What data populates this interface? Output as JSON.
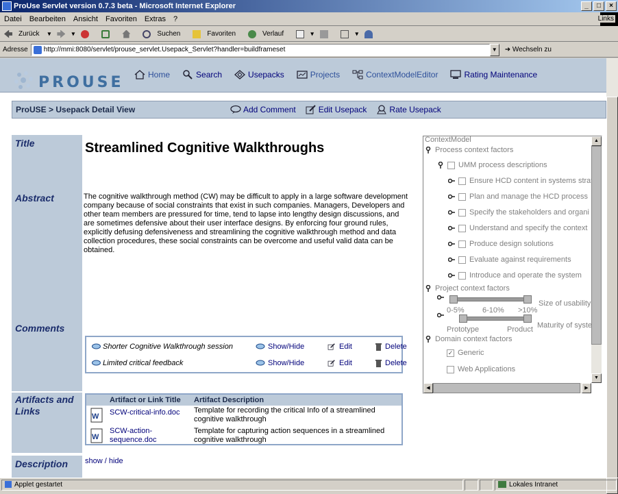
{
  "window": {
    "title": "ProUse Servlet version 0.7.3 beta - Microsoft Internet Explorer"
  },
  "menubar": {
    "items": [
      "Datei",
      "Bearbeiten",
      "Ansicht",
      "Favoriten",
      "Extras",
      "?"
    ],
    "links_label": "Links"
  },
  "toolbar": {
    "back": "Zurück",
    "search": "Suchen",
    "favorites": "Favoriten",
    "history": "Verlauf"
  },
  "addressbar": {
    "label": "Adresse",
    "url": "http://mmi:8080/servlet/prouse_servlet.Usepack_Servlet?handler=buildframeset",
    "go_label": "Wechseln zu"
  },
  "header": {
    "logo": "PROUSE",
    "nav": {
      "home": "Home",
      "search": "Search",
      "usepacks": "Usepacks",
      "projects": "Projects",
      "context_model_editor": "ContextModelEditor",
      "rating_maintenance": "Rating Maintenance"
    }
  },
  "subheader": {
    "breadcrumb": "ProUSE > Usepack Detail View",
    "add_comment": "Add Comment",
    "edit_usepack": "Edit Usepack",
    "rate_usepack": "Rate Usepack"
  },
  "labels": {
    "title": "Title",
    "abstract": "Abstract",
    "comments": "Comments",
    "artifacts": "Artifacts and Links",
    "description": "Description"
  },
  "usepack": {
    "title": "Streamlined Cognitive Walkthroughs",
    "abstract": "The cognitive walkthrough method (CW) may be difficult to apply in a large software development company because of social constraints that exist in such companies. Managers, Developers and other team members are pressured for time, tend to lapse into lengthy design discussions, and are sometimes defensive about their user interface designs. By enforcing four ground rules, explicitly defusing defensiveness and streamlining the cognitive walkthrough method and data collection procedures, these social constraints can be overcome and useful valid data can be obtained."
  },
  "comments": [
    {
      "title": "Shorter Cognitive Walkthrough session",
      "show_hide": "Show/Hide",
      "edit": "Edit",
      "delete": "Delete"
    },
    {
      "title": "Limited critical feedback",
      "show_hide": "Show/Hide",
      "edit": "Edit",
      "delete": "Delete"
    }
  ],
  "artifacts": {
    "headers": [
      "Artifact or Link Title",
      "Artifact Description"
    ],
    "rows": [
      {
        "title": "SCW-critical-info.doc",
        "description": "Template for recording the critical Info of a streamlined cognitive walkthrough"
      },
      {
        "title": "SCW-action-sequence.doc",
        "description": "Template for capturing action sequences in a streamlined cognitive walkthrough"
      }
    ]
  },
  "description": {
    "toggle": "show / hide"
  },
  "context_model": {
    "root": "ContextModel",
    "process_factors": "Process context factors",
    "umm": "UMM process descriptions",
    "processes": [
      "Ensure HCD content in systems strat",
      "Plan and manage the HCD process",
      "Specify the stakeholders and organi",
      "Understand and specify the context",
      "Produce design solutions",
      "Evaluate against requirements",
      "Introduce and operate the system"
    ],
    "project_factors": "Project context factors",
    "size_slider": {
      "ticks": [
        "0-5%",
        "6-10%",
        ">10%"
      ],
      "label": "Size of usability t"
    },
    "maturity_slider": {
      "ticks": [
        "Prototype",
        "Product"
      ],
      "label": "Maturity of syste"
    },
    "domain_factors": "Domain context factors",
    "domains": [
      {
        "label": "Generic",
        "checked": true
      },
      {
        "label": "Web Applications",
        "checked": false
      }
    ]
  },
  "status": {
    "left": "Applet gestartet",
    "zone": "Lokales Intranet"
  },
  "colors": {
    "header_bg": "#bccad9",
    "label_text": "#1a2c6b",
    "link": "#00007a",
    "titlebar": "#0a246a"
  }
}
